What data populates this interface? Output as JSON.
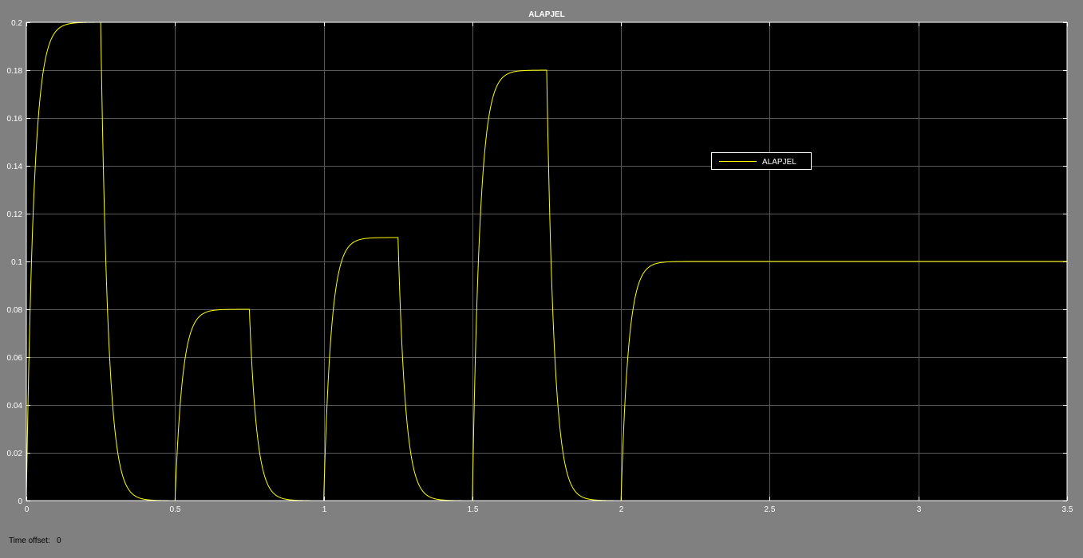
{
  "window": {
    "time_offset_label": "Time offset:",
    "time_offset_value": "0"
  },
  "colors": {
    "figure_bg": "#808080",
    "axes_bg": "#000000",
    "grid": "#5a5a5a",
    "axis_text": "#ffffff",
    "signal": "#ffff00"
  },
  "chart_data": {
    "type": "line",
    "title": "ALAPJEL",
    "xlabel": "",
    "ylabel": "",
    "xlim": [
      0,
      3.5
    ],
    "ylim": [
      0,
      0.2
    ],
    "grid": true,
    "legend_position": "right-center",
    "x_ticks": [
      "0",
      "0.5",
      "1",
      "1.5",
      "2",
      "2.5",
      "3",
      "3.5"
    ],
    "y_ticks": [
      "0",
      "0.02",
      "0.04",
      "0.06",
      "0.08",
      "0.1",
      "0.12",
      "0.14",
      "0.16",
      "0.18",
      "0.2"
    ],
    "series": [
      {
        "name": "ALAPJEL",
        "color": "#ffff00",
        "description_of_input": "step reference filtered by first-order lag",
        "time_constant": 0.025,
        "steps": [
          {
            "t": 0,
            "value": 0.2
          },
          {
            "t": 0.25,
            "value": 0
          },
          {
            "t": 0.5,
            "value": 0.08
          },
          {
            "t": 0.75,
            "value": 0
          },
          {
            "t": 1.0,
            "value": 0.11
          },
          {
            "t": 1.25,
            "value": 0
          },
          {
            "t": 1.5,
            "value": 0.18
          },
          {
            "t": 1.75,
            "value": 0
          },
          {
            "t": 2.0,
            "value": 0.1
          }
        ],
        "t_end": 3.5
      }
    ]
  }
}
